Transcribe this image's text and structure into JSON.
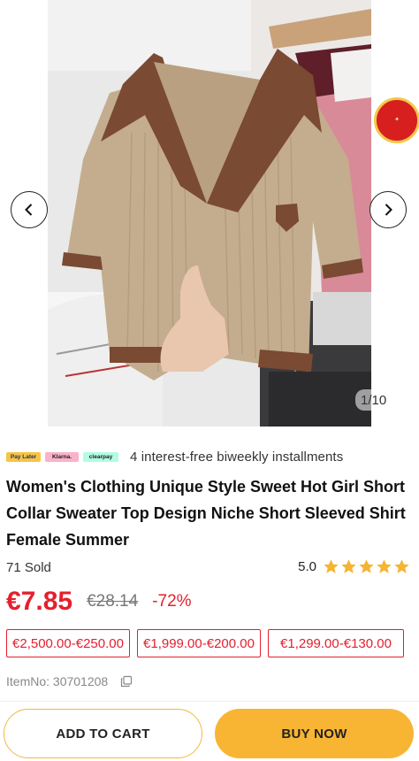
{
  "gallery": {
    "counter": "1/10",
    "prev_icon": "chevron-left-icon",
    "next_icon": "chevron-right-icon",
    "promo_badge_icon": "promo-badge-icon"
  },
  "payment": {
    "logos": [
      "Pay Later",
      "Klarna.",
      "clearpay"
    ],
    "text": "4 interest-free biweekly installments"
  },
  "product": {
    "title": "Women's Clothing Unique Style Sweet Hot Girl Short Collar Sweater Top Design Niche Short Sleeved Shirt Female Summer",
    "sold": "71 Sold",
    "rating": "5.0",
    "rating_stars": 5,
    "price": "€7.85",
    "original_price": "€28.14",
    "discount": "-72%",
    "coupons": [
      "€2,500.00-€250.00",
      "€1,999.00-€200.00",
      "€1,299.00-€130.00"
    ],
    "item_no": "ItemNo: 30701208"
  },
  "actions": {
    "add_to_cart": "ADD TO CART",
    "buy_now": "BUY NOW"
  },
  "colors": {
    "price_red": "#e4202e",
    "buy_yellow": "#f8b533",
    "star_yellow": "#f5b431"
  }
}
